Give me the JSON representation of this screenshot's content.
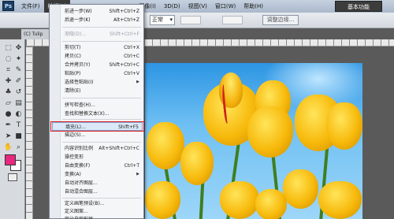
{
  "app": {
    "logo": "Ps",
    "workspace_label": "基本功能"
  },
  "menubar": [
    {
      "label": "文件(F)",
      "active": false
    },
    {
      "label": "编辑(E)",
      "active": true
    },
    {
      "label": "图像(I)",
      "active": false
    },
    {
      "label": "3D(D)",
      "active": false
    },
    {
      "label": "视图(V)",
      "active": false
    },
    {
      "label": "窗口(W)",
      "active": false
    },
    {
      "label": "帮助(H)",
      "active": false
    }
  ],
  "options": {
    "mode_label": "式:",
    "mode_value": "正常",
    "refine_button": "调整边缘..."
  },
  "document": {
    "tab_label": "(C) Tulip"
  },
  "colors": {
    "foreground": "#e8287f",
    "background": "#ffffff",
    "menu_highlight_border": "#e01b1b"
  },
  "edit_menu": {
    "items": [
      {
        "label": "前进一步(W)",
        "shortcut": "Shift+Ctrl+Z",
        "disabled": false
      },
      {
        "label": "后退一步(K)",
        "shortcut": "Alt+Ctrl+Z",
        "disabled": false
      },
      {
        "label": "渐隐(D)...",
        "shortcut": "Shift+Ctrl+F",
        "disabled": true
      },
      {
        "label": "剪切(T)",
        "shortcut": "Ctrl+X",
        "disabled": false
      },
      {
        "label": "拷贝(C)",
        "shortcut": "Ctrl+C",
        "disabled": false
      },
      {
        "label": "合并拷贝(Y)",
        "shortcut": "Shift+Ctrl+C",
        "disabled": false
      },
      {
        "label": "粘贴(P)",
        "shortcut": "Ctrl+V",
        "disabled": false
      },
      {
        "label": "选择性粘贴(I)",
        "shortcut": "",
        "disabled": false
      },
      {
        "label": "清除(E)",
        "shortcut": "",
        "disabled": false
      },
      {
        "label": "拼写检查(H)...",
        "shortcut": "",
        "disabled": false
      },
      {
        "label": "查找和替换文本(X)...",
        "shortcut": "",
        "disabled": false
      },
      {
        "label": "填充(L)...",
        "shortcut": "Shift+F5",
        "disabled": false
      },
      {
        "label": "描边(S)...",
        "shortcut": "",
        "disabled": false
      },
      {
        "label": "内容识别比例",
        "shortcut": "Alt+Shift+Ctrl+C",
        "disabled": false
      },
      {
        "label": "操控变形",
        "shortcut": "",
        "disabled": false
      },
      {
        "label": "自由变换(F)",
        "shortcut": "Ctrl+T",
        "disabled": false
      },
      {
        "label": "变换(A)",
        "shortcut": "",
        "disabled": false
      },
      {
        "label": "自动对齐图层...",
        "shortcut": "",
        "disabled": false
      },
      {
        "label": "自动混合图层...",
        "shortcut": "",
        "disabled": false
      },
      {
        "label": "定义画笔预设(B)...",
        "shortcut": "",
        "disabled": false
      },
      {
        "label": "定义图案...",
        "shortcut": "",
        "disabled": false
      },
      {
        "label": "定义自定形状...",
        "shortcut": "",
        "disabled": false
      }
    ]
  }
}
